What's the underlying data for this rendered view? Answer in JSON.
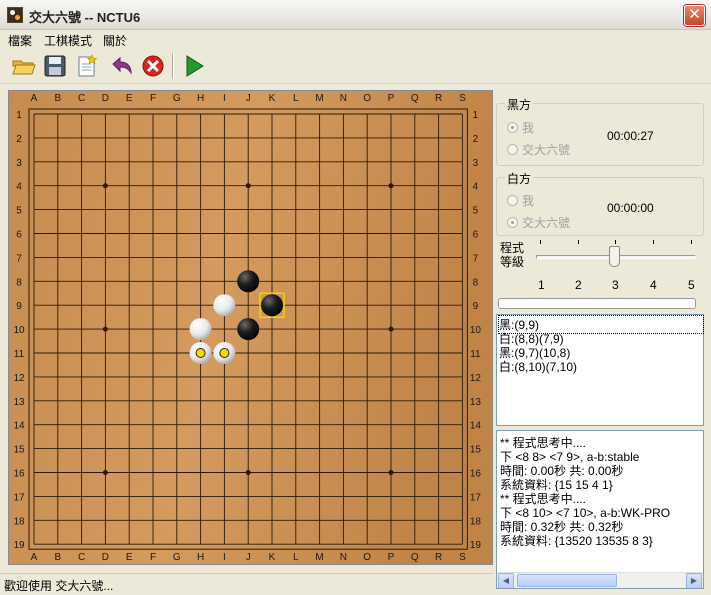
{
  "window": {
    "title": "交大六號 -- NCTU6"
  },
  "menu": [
    "檔案",
    "工棋模式",
    "關於"
  ],
  "toolbar": {
    "buttons": [
      "open-folder-icon",
      "save-disk-icon",
      "new-document-icon",
      "undo-arrow-icon",
      "delete-x-icon",
      "play-icon"
    ]
  },
  "board": {
    "columns": [
      "A",
      "B",
      "C",
      "D",
      "E",
      "F",
      "G",
      "H",
      "I",
      "J",
      "K",
      "L",
      "M",
      "N",
      "O",
      "P",
      "Q",
      "R",
      "S"
    ],
    "rows": [
      "1",
      "2",
      "3",
      "4",
      "5",
      "6",
      "7",
      "8",
      "9",
      "10",
      "11",
      "12",
      "13",
      "14",
      "15",
      "16",
      "17",
      "18",
      "19"
    ],
    "star_points": [
      "D4",
      "J4",
      "P4",
      "D10",
      "J10",
      "P10",
      "D16",
      "J16",
      "P16"
    ],
    "stones": [
      {
        "color": "black",
        "pos": "J8"
      },
      {
        "color": "white",
        "pos": "I9"
      },
      {
        "color": "black",
        "pos": "K9",
        "last_move": true
      },
      {
        "color": "white",
        "pos": "H10"
      },
      {
        "color": "black",
        "pos": "J10"
      },
      {
        "color": "white",
        "pos": "H11",
        "marked": true
      },
      {
        "color": "white",
        "pos": "I11",
        "marked": true
      }
    ],
    "colors": {
      "wood": "#c68d52",
      "line": "#2a1a0a",
      "mark": "#ffd800",
      "last_move_box": "#f2d000"
    }
  },
  "black_panel": {
    "label": "黑方",
    "options": [
      {
        "label": "我",
        "checked": true
      },
      {
        "label": "交大六號",
        "checked": false
      }
    ],
    "time": "00:00:27"
  },
  "white_panel": {
    "label": "白方",
    "options": [
      {
        "label": "我",
        "checked": false
      },
      {
        "label": "交大六號",
        "checked": true
      }
    ],
    "time": "00:00:00"
  },
  "level": {
    "label_line1": "程式",
    "label_line2": "等級",
    "ticks": [
      "1",
      "2",
      "3",
      "4",
      "5"
    ],
    "value": 3
  },
  "moves": [
    "黑:(9,9)",
    "白:(8,8)(7,9)",
    "黑:(9,7)(10,8)",
    "白:(8,10)(7,10)"
  ],
  "log": [
    "** 程式思考中....",
    "下 <8 8> <7 9>, a-b:stable",
    "時間:   0.00秒  共:   0.00秒",
    "系統資料: {15 15 4 1}",
    "** 程式思考中....",
    "下 <8 10> <7 10>, a-b:WK-PRO",
    "時間:   0.32秒  共:   0.32秒",
    "系統資料: {13520 13535 8 3}"
  ],
  "status": "歡迎使用 交大六號..."
}
